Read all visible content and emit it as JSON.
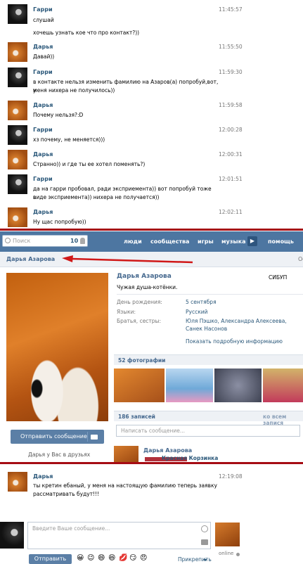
{
  "chat_top": {
    "messages": [
      {
        "name": "Гарри",
        "time": "11:45:57",
        "lines": [
          "слушай",
          "хочешь узнать кое что про контакт?))"
        ]
      },
      {
        "name": "Дарья",
        "time": "11:55:50",
        "lines": [
          "Давай))"
        ]
      },
      {
        "name": "Гарри",
        "time": "11:59:30",
        "lines": [
          "в контакте нельзя изменить фамилию на Азаров(а) попробуй,вот, у",
          "меня нихера не получилось))"
        ]
      },
      {
        "name": "Дарья",
        "time": "11:59:58",
        "lines": [
          "Почему нельзя?:D"
        ]
      },
      {
        "name": "Гарри",
        "time": "12:00:28",
        "lines": [
          "хз почему, не меняется)))"
        ]
      },
      {
        "name": "Дарья",
        "time": "12:00:31",
        "lines": [
          "Странно)) и где ты ее хотел поменять?)"
        ]
      },
      {
        "name": "Гарри",
        "time": "12:01:51",
        "lines": [
          "да на гарри пробовал, ради эксприемента)) вот попробуй тоже в",
          "виде эксприемента)) нихера не получается))"
        ]
      },
      {
        "name": "Дарья",
        "time": "12:02:11",
        "lines": [
          "Ну щас попробую))"
        ]
      }
    ]
  },
  "vk_header": {
    "search_placeholder": "Поиск",
    "search_count": "10",
    "nav": [
      "люди",
      "сообщества",
      "игры",
      "музыка",
      "помощь"
    ],
    "nav_more": "▶"
  },
  "breadcrumb": {
    "title": "Дарья Азарова",
    "right": "Ос"
  },
  "profile": {
    "name": "Дарья Азарова",
    "status": "Чужая душа-котёнки.",
    "university": "СИБУП",
    "fields": [
      {
        "label": "День рождения:",
        "value": "5 сентября"
      },
      {
        "label": "Языки:",
        "value": "Русский"
      },
      {
        "label": "Братья, сестры:",
        "value": "Юля Пэшко, Александра Алексеева, Санек Насонов"
      }
    ],
    "more_info": "Показать подробную информацию",
    "send_message": "Отправить сообщение",
    "friends_note": "Дарья у Вас в друзьях",
    "photos_title": "52 фотографии",
    "posts_title": "186 записей",
    "posts_right": "ко всем запися",
    "post_placeholder": "Написать сообщение...",
    "wall_name": "Дарья Азарова",
    "wall_sub": "Красная Корзинка"
  },
  "chat_bottom": {
    "name": "Дарья",
    "time": "12:19:08",
    "lines": [
      "ты кретин ебаный, у меня на настоящую фамилию теперь заявку",
      "рассматривать будут!!!"
    ],
    "composer_placeholder": "Введите Ваше сообщение...",
    "send_label": "Отправить",
    "attach_label": "Прикрепить",
    "online_label": "online",
    "emojis": [
      "😀",
      "😉",
      "😄",
      "😆",
      "💋",
      "😏",
      "😠"
    ]
  },
  "colors": {
    "accent": "#4d76a1",
    "link": "#2b587a",
    "divider": "#a60c14"
  }
}
